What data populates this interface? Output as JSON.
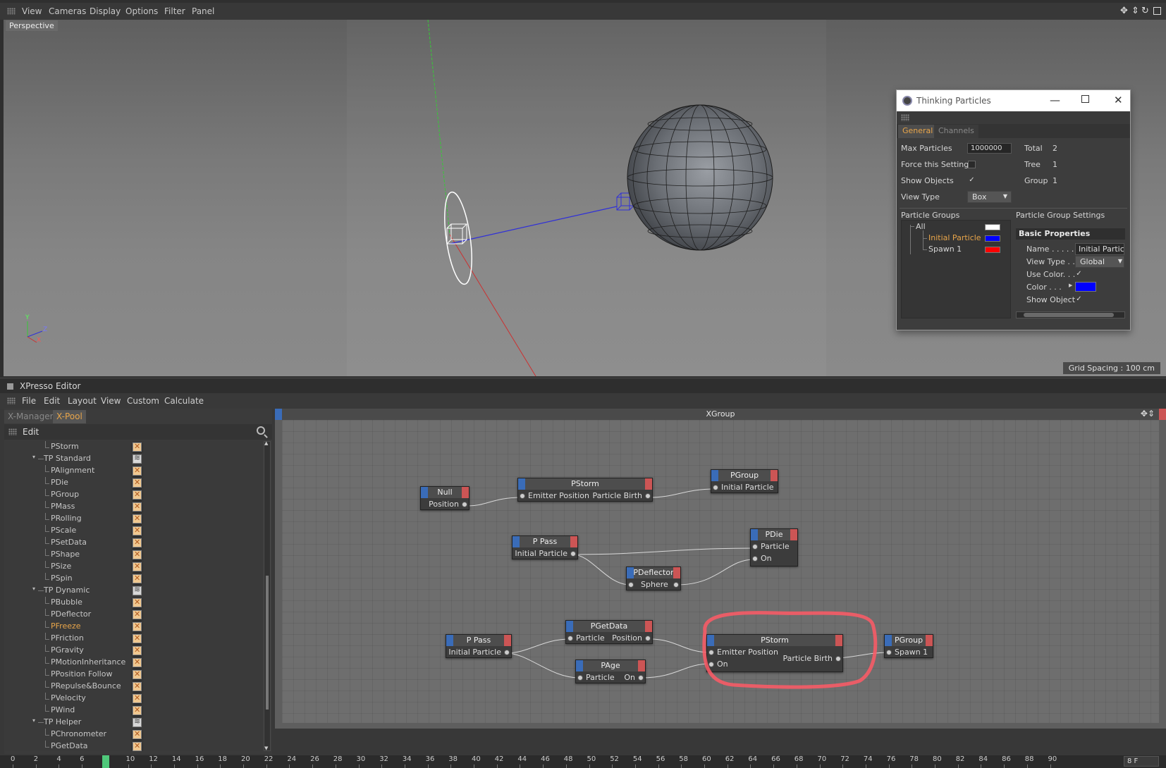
{
  "viewport": {
    "menu": [
      "View",
      "Cameras",
      "Display",
      "Options",
      "Filter",
      "Panel"
    ],
    "label": "Perspective",
    "grid_spacing": "Grid Spacing : 100 cm",
    "axis_labels": {
      "y": "Y",
      "z": "Z",
      "x": "X"
    },
    "controls": [
      "move-icon",
      "zoom-icon",
      "rotate-icon",
      "maximize-icon"
    ]
  },
  "tp_window": {
    "title": "Thinking Particles",
    "tabs": [
      "General",
      "Channels"
    ],
    "max_particles_label": "Max Particles",
    "max_particles_value": "1000000",
    "force_setting_label": "Force this Setting",
    "show_objects_label": "Show Objects",
    "view_type_label": "View Type",
    "view_type_value": "Box",
    "total_label": "Total",
    "total_value": "2",
    "tree_label": "Tree",
    "tree_value": "1",
    "group_label": "Group",
    "group_value": "1",
    "particle_groups_label": "Particle Groups",
    "particle_group_settings_label": "Particle Group Settings",
    "groups": [
      {
        "name": "All",
        "color": "#ffffff"
      },
      {
        "name": "Initial Particle",
        "color": "#0000ff"
      },
      {
        "name": "Spawn 1",
        "color": "#ff0000"
      }
    ],
    "basic_properties": "Basic Properties",
    "name_label": "Name . . . . . .",
    "name_value": "Initial Partic",
    "pg_view_type_label": "View Type . .",
    "pg_view_type_value": "Global",
    "use_color_label": "Use Color. . .",
    "color_label": "Color . . .",
    "color_value": "#0000ff",
    "show_object_label": "Show Object"
  },
  "xpresso": {
    "title": "XPresso Editor",
    "menu": [
      "File",
      "Edit",
      "Layout",
      "View",
      "Custom",
      "Calculate"
    ],
    "tabs": [
      "X-Manager",
      "X-Pool"
    ],
    "toolbar_edit": "Edit",
    "tree": [
      {
        "label": "PStorm",
        "level": 2,
        "icon": "node"
      },
      {
        "label": "TP Standard",
        "level": 1,
        "icon": "folder"
      },
      {
        "label": "PAlignment",
        "level": 2,
        "icon": "node"
      },
      {
        "label": "PDie",
        "level": 2,
        "icon": "node"
      },
      {
        "label": "PGroup",
        "level": 2,
        "icon": "node"
      },
      {
        "label": "PMass",
        "level": 2,
        "icon": "node"
      },
      {
        "label": "PRolling",
        "level": 2,
        "icon": "node"
      },
      {
        "label": "PScale",
        "level": 2,
        "icon": "node"
      },
      {
        "label": "PSetData",
        "level": 2,
        "icon": "node"
      },
      {
        "label": "PShape",
        "level": 2,
        "icon": "node"
      },
      {
        "label": "PSize",
        "level": 2,
        "icon": "node"
      },
      {
        "label": "PSpin",
        "level": 2,
        "icon": "node"
      },
      {
        "label": "TP Dynamic",
        "level": 1,
        "icon": "folder"
      },
      {
        "label": "PBubble",
        "level": 2,
        "icon": "node"
      },
      {
        "label": "PDeflector",
        "level": 2,
        "icon": "node"
      },
      {
        "label": "PFreeze",
        "level": 2,
        "icon": "node",
        "highlight": true
      },
      {
        "label": "PFriction",
        "level": 2,
        "icon": "node"
      },
      {
        "label": "PGravity",
        "level": 2,
        "icon": "node"
      },
      {
        "label": "PMotionInheritance",
        "level": 2,
        "icon": "node"
      },
      {
        "label": "PPosition Follow",
        "level": 2,
        "icon": "node"
      },
      {
        "label": "PRepulse&Bounce",
        "level": 2,
        "icon": "node"
      },
      {
        "label": "PVelocity",
        "level": 2,
        "icon": "node"
      },
      {
        "label": "PWind",
        "level": 2,
        "icon": "node"
      },
      {
        "label": "TP Helper",
        "level": 1,
        "icon": "folder"
      },
      {
        "label": "PChronometer",
        "level": 2,
        "icon": "node"
      },
      {
        "label": "PGetData",
        "level": 2,
        "icon": "node"
      }
    ],
    "graph_title": "XGroup",
    "nodes": {
      "null": {
        "title": "Null",
        "out": "Position"
      },
      "pstorm1": {
        "title": "PStorm",
        "in": "Emitter Position",
        "out": "Particle Birth"
      },
      "pgroup1": {
        "title": "PGroup",
        "in": "Initial Particle"
      },
      "ppass1": {
        "title": "P Pass",
        "out": "Initial Particle"
      },
      "pdie": {
        "title": "PDie",
        "in1": "Particle",
        "in2": "On"
      },
      "pdeflector": {
        "title": "PDeflector",
        "out": "Sphere"
      },
      "ppass2": {
        "title": "P Pass",
        "out": "Initial Particle"
      },
      "pgetdata": {
        "title": "PGetData",
        "in": "Particle",
        "out": "Position"
      },
      "page": {
        "title": "PAge",
        "in": "Particle",
        "out": "On"
      },
      "pstorm2": {
        "title": "PStorm",
        "in1": "Emitter Position",
        "in2": "On",
        "out": "Particle Birth"
      },
      "pgroup2": {
        "title": "PGroup",
        "in": "Spawn 1"
      }
    }
  },
  "timeline": {
    "ticks": [
      "0",
      "2",
      "4",
      "6",
      "8",
      "10",
      "12",
      "14",
      "16",
      "18",
      "20",
      "22",
      "24",
      "26",
      "28",
      "30",
      "32",
      "34",
      "36",
      "38",
      "40",
      "42",
      "44",
      "46",
      "48",
      "50",
      "52",
      "54",
      "56",
      "58",
      "60",
      "62",
      "64",
      "66",
      "68",
      "70",
      "72",
      "74",
      "76",
      "78",
      "80",
      "82",
      "84",
      "86",
      "88",
      "90"
    ],
    "current_frame": "8",
    "frame_field": "8 F"
  },
  "accent_colors": {
    "orange": "#e8a54a",
    "pin_blue": "#3a6cb8",
    "pin_red": "#cc5555",
    "highlight_ring": "#ff5a66"
  }
}
